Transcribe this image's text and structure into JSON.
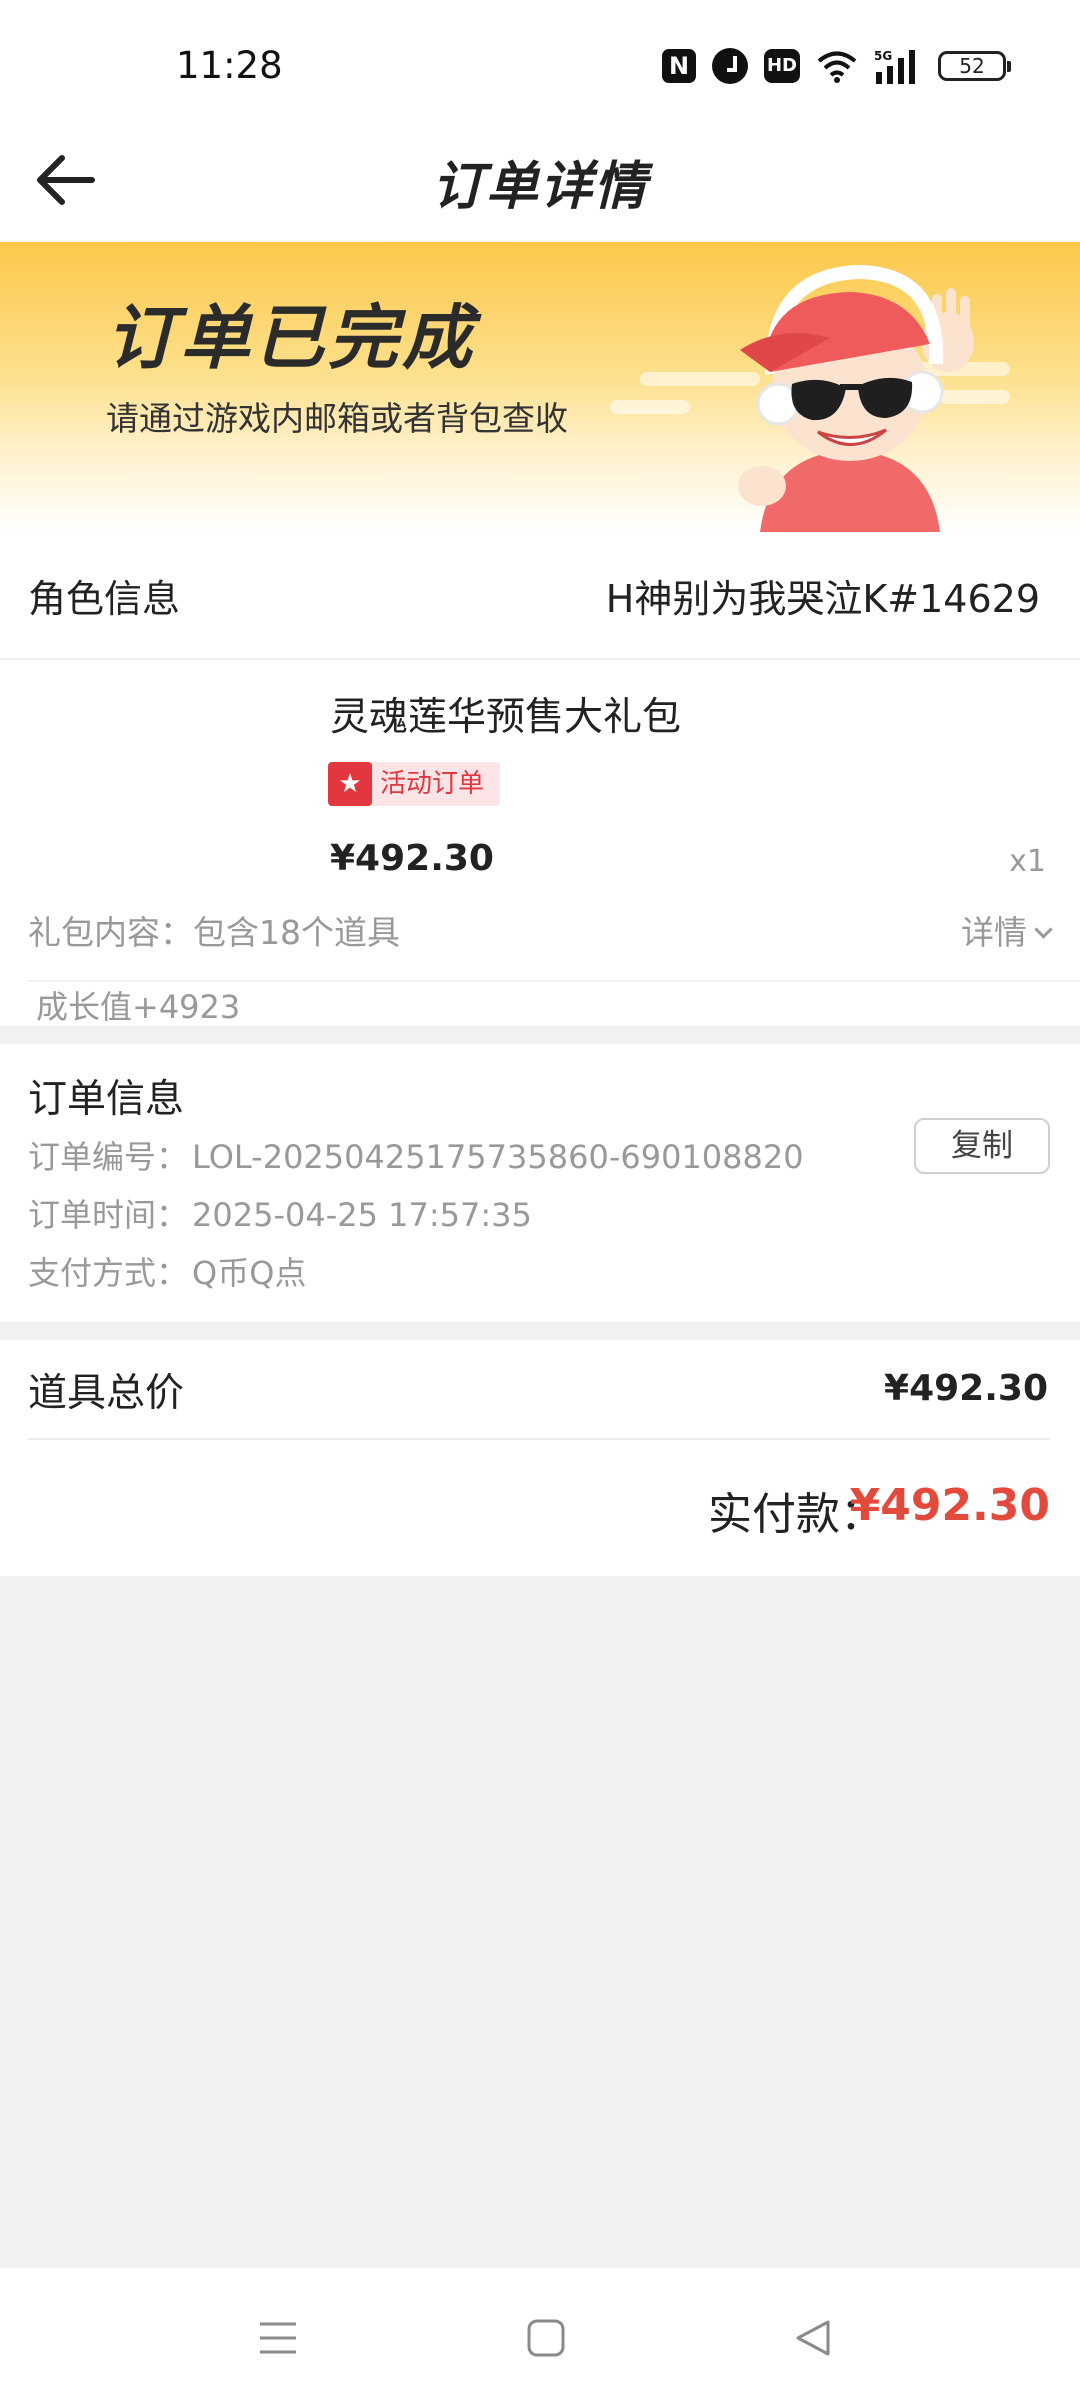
{
  "status_bar": {
    "time": "11:28",
    "nfc": "N",
    "hd": "HD",
    "network": "5G",
    "battery": "52"
  },
  "header": {
    "title": "订单详情"
  },
  "banner": {
    "title": "订单已完成",
    "subtitle": "请通过游戏内邮箱或者背包查收"
  },
  "role": {
    "label": "角色信息",
    "value": "H神别为我哭泣K#14629"
  },
  "product": {
    "name": "灵魂莲华预售大礼包",
    "badge": "活动订单",
    "price": "¥492.30",
    "quantity": "x1",
    "gift_label": "礼包内容：",
    "gift_value": "包含18个道具",
    "detail_label": "详情",
    "growth": "成长值+4923"
  },
  "order_info": {
    "title": "订单信息",
    "number_label": "订单编号：",
    "number_value": "LOL-20250425175735860-690108820",
    "time_label": "订单时间：",
    "time_value": "2025-04-25 17:57:35",
    "pay_label": "支付方式：",
    "pay_value": "Q币Q点",
    "copy_button": "复制"
  },
  "totals": {
    "items_label": "道具总价",
    "items_value": "¥492.30",
    "paid_label": "实付款：",
    "paid_value": "¥492.30"
  },
  "colors": {
    "banner_top": "#fbc84a",
    "accent_red": "#e34a3c",
    "badge_red": "#e2373f",
    "muted_text": "#999999",
    "page_bg": "#f1f1f1"
  },
  "icons": [
    "back-arrow-icon",
    "nfc-icon",
    "alarm-icon",
    "hd-icon",
    "wifi-icon",
    "signal-icon",
    "battery-icon",
    "star-badge-icon",
    "chevron-down-icon",
    "menu-icon",
    "home-icon",
    "back-triangle-icon"
  ]
}
